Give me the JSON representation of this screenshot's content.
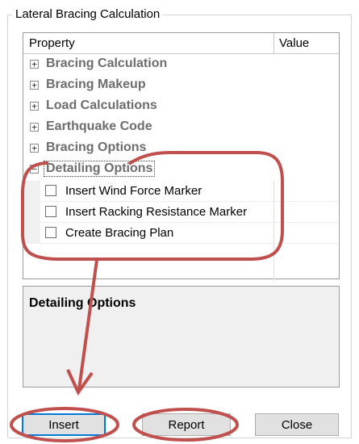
{
  "window": {
    "group_title": "Lateral Bracing Calculation"
  },
  "grid": {
    "headers": {
      "property": "Property",
      "value": "Value"
    },
    "categories": [
      {
        "label": "Bracing Calculation",
        "expander": "+"
      },
      {
        "label": "Bracing Makeup",
        "expander": "+"
      },
      {
        "label": "Load Calculations",
        "expander": "+"
      },
      {
        "label": "Earthquake Code",
        "expander": "+"
      },
      {
        "label": "Bracing Options",
        "expander": "+"
      },
      {
        "label": "Detailing Options",
        "expander": "−"
      }
    ],
    "detailing_items": [
      {
        "label": "Insert Wind Force Marker",
        "checked": false
      },
      {
        "label": "Insert Racking Resistance Marker",
        "checked": false
      },
      {
        "label": "Create Bracing Plan",
        "checked": false
      }
    ]
  },
  "description": {
    "title": "Detailing Options"
  },
  "buttons": {
    "insert": "Insert",
    "report": "Report",
    "close": "Close"
  },
  "annotation": {
    "color": "#c0504d"
  }
}
